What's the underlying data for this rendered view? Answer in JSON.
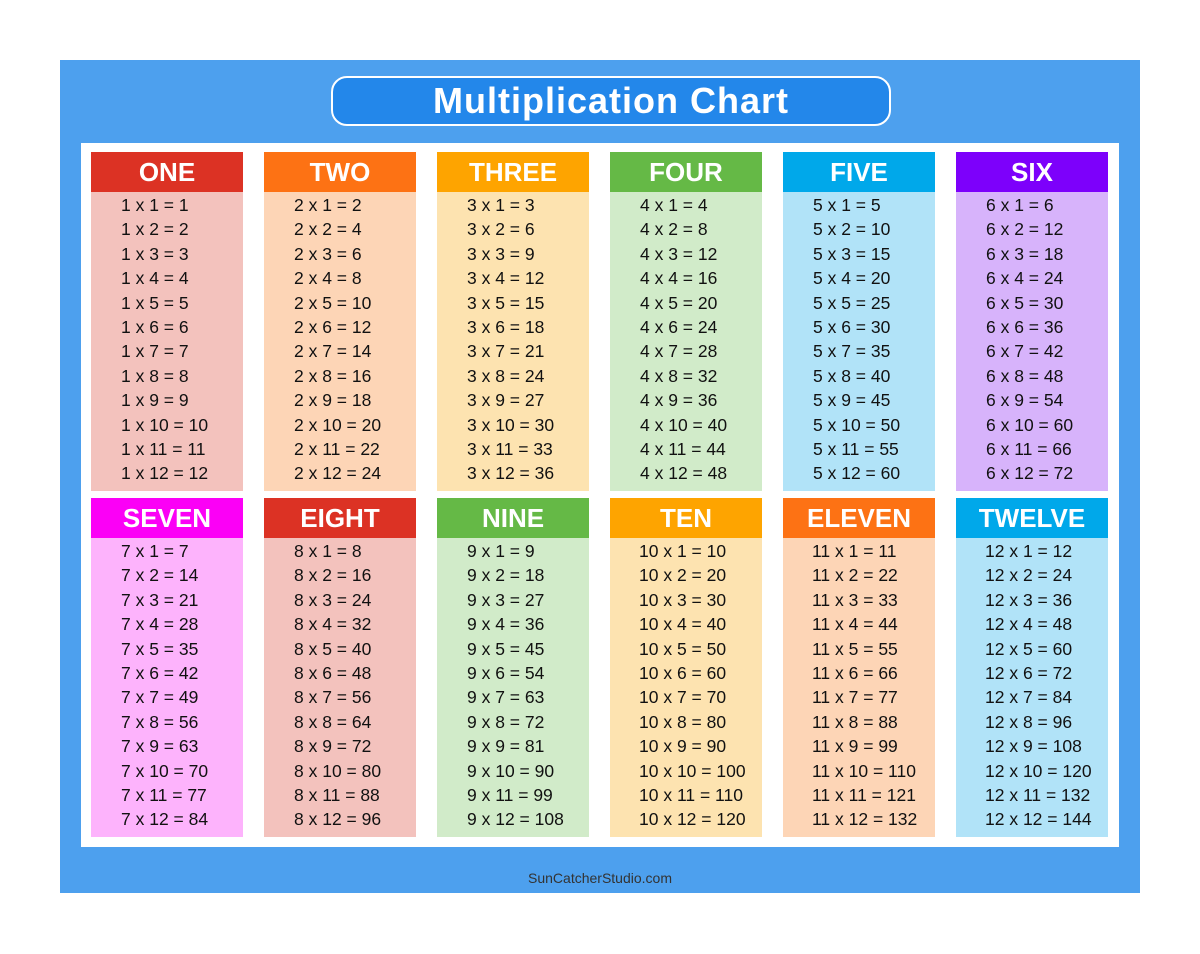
{
  "title": "Multiplication Chart",
  "footer": "SunCatcherStudio.com",
  "tables": [
    {
      "name": "ONE",
      "n": 1,
      "head_color": "#dc3224",
      "body_color": "#f3c2bd"
    },
    {
      "name": "TWO",
      "n": 2,
      "head_color": "#fd7214",
      "body_color": "#fdd5b6"
    },
    {
      "name": "THREE",
      "n": 3,
      "head_color": "#fea400",
      "body_color": "#fde3b0"
    },
    {
      "name": "FOUR",
      "n": 4,
      "head_color": "#65b946",
      "body_color": "#d1ebc9"
    },
    {
      "name": "FIVE",
      "n": 5,
      "head_color": "#00a8ea",
      "body_color": "#b1e3f8"
    },
    {
      "name": "SIX",
      "n": 6,
      "head_color": "#7d00fb",
      "body_color": "#d7b3fb"
    },
    {
      "name": "SEVEN",
      "n": 7,
      "head_color": "#fb00f6",
      "body_color": "#fdb3fc"
    },
    {
      "name": "EIGHT",
      "n": 8,
      "head_color": "#dc3224",
      "body_color": "#f3c2bd"
    },
    {
      "name": "NINE",
      "n": 9,
      "head_color": "#65b946",
      "body_color": "#d1ebc9"
    },
    {
      "name": "TEN",
      "n": 10,
      "head_color": "#fea400",
      "body_color": "#fde3b0"
    },
    {
      "name": "ELEVEN",
      "n": 11,
      "head_color": "#fd7214",
      "body_color": "#fdd5b6"
    },
    {
      "name": "TWELVE",
      "n": 12,
      "head_color": "#00a8ea",
      "body_color": "#b1e3f8"
    }
  ],
  "facts": {
    "t1": [
      "1 x 1 = 1",
      "1 x 2 = 2",
      "1 x 3 = 3",
      "1 x 4 = 4",
      "1 x 5 = 5",
      "1 x 6 = 6",
      "1 x 7 = 7",
      "1 x 8 = 8",
      "1 x 9 = 9",
      "1 x 10 = 10",
      "1 x 11 = 11",
      "1 x 12 = 12"
    ],
    "t2": [
      "2 x 1 = 2",
      "2 x 2 = 4",
      "2 x 3 = 6",
      "2 x 4 = 8",
      "2 x 5 = 10",
      "2 x 6 = 12",
      "2 x 7 = 14",
      "2 x 8 = 16",
      "2 x 9 = 18",
      "2 x 10 = 20",
      "2 x 11 = 22",
      "2 x 12 = 24"
    ],
    "t3": [
      "3 x 1 = 3",
      "3 x 2 = 6",
      "3 x 3 = 9",
      "3 x 4 = 12",
      "3 x 5 = 15",
      "3 x 6 = 18",
      "3 x 7 = 21",
      "3 x 8 = 24",
      "3 x 9 = 27",
      "3 x 10 = 30",
      "3 x 11 = 33",
      "3 x 12 = 36"
    ],
    "t4": [
      "4 x 1 = 4",
      "4 x 2 = 8",
      "4 x 3 = 12",
      "4 x 4 = 16",
      "4 x 5 = 20",
      "4 x 6 = 24",
      "4 x 7 = 28",
      "4 x 8 = 32",
      "4 x 9 = 36",
      "4 x 10 = 40",
      "4 x 11 = 44",
      "4 x 12 = 48"
    ],
    "t5": [
      "5 x 1 = 5",
      "5 x 2 = 10",
      "5 x 3 = 15",
      "5 x 4 = 20",
      "5 x 5 = 25",
      "5 x 6 = 30",
      "5 x 7 = 35",
      "5 x 8 = 40",
      "5 x 9 = 45",
      "5 x 10 = 50",
      "5 x 11 = 55",
      "5 x 12 = 60"
    ],
    "t6": [
      "6 x 1 = 6",
      "6 x 2 = 12",
      "6 x 3 = 18",
      "6 x 4 = 24",
      "6 x 5 = 30",
      "6 x 6 = 36",
      "6 x 7 = 42",
      "6 x 8 = 48",
      "6 x 9 = 54",
      "6 x 10 = 60",
      "6 x 11 = 66",
      "6 x 12 = 72"
    ],
    "t7": [
      "7 x 1 = 7",
      "7 x 2 = 14",
      "7 x 3 = 21",
      "7 x 4 = 28",
      "7 x 5 = 35",
      "7 x 6 = 42",
      "7 x 7 = 49",
      "7 x 8 = 56",
      "7 x 9 = 63",
      "7 x 10 = 70",
      "7 x 11 = 77",
      "7 x 12 = 84"
    ],
    "t8": [
      "8 x 1 = 8",
      "8 x 2 = 16",
      "8 x 3 = 24",
      "8 x 4 = 32",
      "8 x 5 = 40",
      "8 x 6 = 48",
      "8 x 7 = 56",
      "8 x 8 = 64",
      "8 x 9 = 72",
      "8 x 10 = 80",
      "8 x 11 = 88",
      "8 x 12 = 96"
    ],
    "t9": [
      "9 x 1 = 9",
      "9 x 2 = 18",
      "9 x 3 = 27",
      "9 x 4 = 36",
      "9 x 5 = 45",
      "9 x 6 = 54",
      "9 x 7 = 63",
      "9 x 8 = 72",
      "9 x 9 = 81",
      "9 x 10 = 90",
      "9 x 11 = 99",
      "9 x 12 = 108"
    ],
    "t10": [
      "10 x 1 = 10",
      "10 x 2 = 20",
      "10 x 3 = 30",
      "10 x 4 = 40",
      "10 x 5 = 50",
      "10 x 6 = 60",
      "10 x 7 = 70",
      "10 x 8 = 80",
      "10 x 9 = 90",
      "10 x 10 = 100",
      "10 x 11 = 110",
      "10 x 12 = 120"
    ],
    "t11": [
      "11 x 1 = 11",
      "11 x 2 = 22",
      "11 x 3 = 33",
      "11 x 4 = 44",
      "11 x 5 = 55",
      "11 x 6 = 66",
      "11 x 7 = 77",
      "11 x 8 = 88",
      "11 x 9 = 99",
      "11 x 10 = 110",
      "11 x 11 = 121",
      "11 x 12 = 132"
    ],
    "t12": [
      "12 x 1 = 12",
      "12 x 2 = 24",
      "12 x 3 = 36",
      "12 x 4 = 48",
      "12 x 5 = 60",
      "12 x 6 = 72",
      "12 x 7 = 84",
      "12 x 8 = 96",
      "12 x 9 = 108",
      "12 x 10 = 120",
      "12 x 11 = 132",
      "12 x 12 = 144"
    ]
  },
  "colors": {
    "frame": "#4da0ee",
    "title_bg": "#2387ea",
    "panel": "#ffffff"
  }
}
